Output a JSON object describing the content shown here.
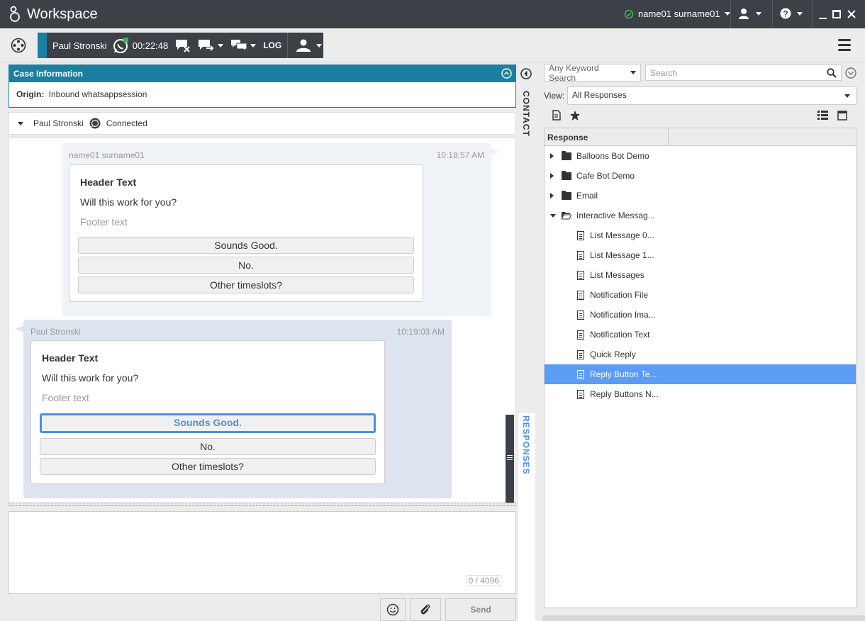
{
  "app": {
    "title": "Workspace",
    "user": "name01 surname01",
    "status_color": "#3cb44b"
  },
  "interaction": {
    "contact_name": "Paul Stronski",
    "timer": "00:22:48",
    "log_label": "LOG"
  },
  "case": {
    "header": "Case Information",
    "origin_label": "Origin:",
    "origin_value": "Inbound whatsappsession"
  },
  "party": {
    "name": "Paul Stronski",
    "state": "Connected"
  },
  "messages": [
    {
      "sender": "name01 surname01",
      "time": "10:18:57 AM",
      "header": "Header Text",
      "body": "Will this work for you?",
      "footer": "Footer text",
      "options": [
        "Sounds Good.",
        "No.",
        "Other timeslots?"
      ]
    },
    {
      "sender": "Paul Stronski",
      "time": "10:19:03 AM",
      "header": "Header Text",
      "body": "Will this work for you?",
      "footer": "Footer text",
      "options": [
        "Sounds Good.",
        "No.",
        "Other timeslots?"
      ],
      "selected_option": "Sounds Good."
    }
  ],
  "composer": {
    "counter": "0 / 4096",
    "send_label": "Send"
  },
  "side_tabs": {
    "contact": "CONTACT",
    "responses": "RESPONSES"
  },
  "responses": {
    "search_scope": "Any Keyword Search",
    "search_placeholder": "Search",
    "view_label": "View:",
    "view_value": "All Responses",
    "column_header": "Response",
    "tree": [
      {
        "label": "Balloons Bot Demo",
        "type": "folder",
        "expanded": false
      },
      {
        "label": "Cafe Bot Demo",
        "type": "folder",
        "expanded": false
      },
      {
        "label": "Email",
        "type": "folder",
        "expanded": false
      },
      {
        "label": "Interactive Messag...",
        "type": "folder",
        "expanded": true
      },
      {
        "label": "List Message 0...",
        "type": "item"
      },
      {
        "label": "List Message 1...",
        "type": "item"
      },
      {
        "label": "List Messages",
        "type": "item"
      },
      {
        "label": "Notification File",
        "type": "item"
      },
      {
        "label": "Notification Ima...",
        "type": "item"
      },
      {
        "label": "Notification Text",
        "type": "item"
      },
      {
        "label": "Quick Reply",
        "type": "item"
      },
      {
        "label": "Reply Button Te...",
        "type": "item",
        "selected": true
      },
      {
        "label": "Reply Buttons N...",
        "type": "item"
      }
    ]
  },
  "colors": {
    "accent": "#1a7fa0",
    "selection": "#5b9cf5",
    "titlebar": "#3b4146"
  }
}
